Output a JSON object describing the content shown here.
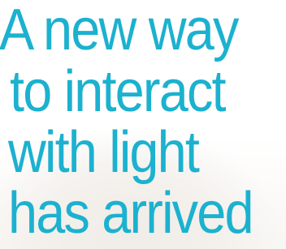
{
  "headline": {
    "lines": [
      "A new way",
      "to interact",
      "with light",
      "has arrived"
    ]
  },
  "colors": {
    "headline_text": "#1cb1cf",
    "background": "#ffffff"
  }
}
